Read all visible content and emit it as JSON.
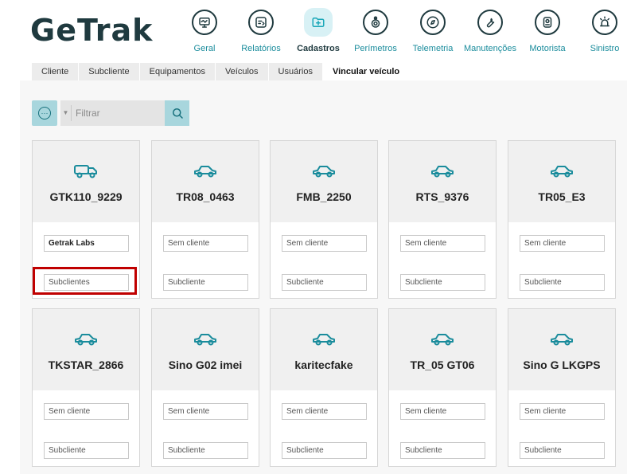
{
  "brand": {
    "logo_text": "GeTrak"
  },
  "nav": [
    {
      "label": "Geral",
      "icon": "monitor-icon",
      "active": false
    },
    {
      "label": "Relatórios",
      "icon": "report-icon",
      "active": false
    },
    {
      "label": "Cadastros",
      "icon": "folder-plus-icon",
      "active": true
    },
    {
      "label": "Perímetros",
      "icon": "geofence-icon",
      "active": false
    },
    {
      "label": "Telemetria",
      "icon": "compass-icon",
      "active": false
    },
    {
      "label": "Manutenções",
      "icon": "wrench-icon",
      "active": false
    },
    {
      "label": "Motorista",
      "icon": "driver-icon",
      "active": false
    },
    {
      "label": "Sinistro",
      "icon": "alarm-icon",
      "active": false
    }
  ],
  "tabs": [
    {
      "label": "Cliente",
      "active": false
    },
    {
      "label": "Subcliente",
      "active": false
    },
    {
      "label": "Equipamentos",
      "active": false
    },
    {
      "label": "Veículos",
      "active": false
    },
    {
      "label": "Usuários",
      "active": false
    },
    {
      "label": "Vincular veículo",
      "active": true
    }
  ],
  "toolbar": {
    "options_icon": "more-options-icon",
    "filter_placeholder": "Filtrar",
    "search_icon": "search-icon"
  },
  "colors": {
    "accent": "#1a8c9c",
    "accent_light": "#a8d6dd",
    "dark": "#1f3a3f",
    "highlight": "#c00000"
  },
  "vehicles": [
    {
      "name": "GTK110_9229",
      "icon": "truck-icon",
      "client_value": "Getrak Labs",
      "client_placeholder": "Sem cliente",
      "subclient_placeholder": "Subclientes"
    },
    {
      "name": "TR08_0463",
      "icon": "car-icon",
      "client_value": "",
      "client_placeholder": "Sem cliente",
      "subclient_placeholder": "Subcliente"
    },
    {
      "name": "FMB_2250",
      "icon": "car-icon",
      "client_value": "",
      "client_placeholder": "Sem cliente",
      "subclient_placeholder": "Subcliente"
    },
    {
      "name": "RTS_9376",
      "icon": "car-icon",
      "client_value": "",
      "client_placeholder": "Sem cliente",
      "subclient_placeholder": "Subcliente"
    },
    {
      "name": "TR05_E3",
      "icon": "car-icon",
      "client_value": "",
      "client_placeholder": "Sem cliente",
      "subclient_placeholder": "Subcliente"
    },
    {
      "name": "TKSTAR_2866",
      "icon": "car-icon",
      "client_value": "",
      "client_placeholder": "Sem cliente",
      "subclient_placeholder": "Subcliente"
    },
    {
      "name": "Sino G02 imei",
      "icon": "car-icon",
      "client_value": "",
      "client_placeholder": "Sem cliente",
      "subclient_placeholder": "Subcliente"
    },
    {
      "name": "karitecfake",
      "icon": "car-icon",
      "client_value": "",
      "client_placeholder": "Sem cliente",
      "subclient_placeholder": "Subcliente"
    },
    {
      "name": "TR_05 GT06",
      "icon": "car-icon",
      "client_value": "",
      "client_placeholder": "Sem cliente",
      "subclient_placeholder": "Subcliente"
    },
    {
      "name": "Sino G LKGPS",
      "icon": "car-icon",
      "client_value": "",
      "client_placeholder": "Sem cliente",
      "subclient_placeholder": "Subcliente"
    }
  ]
}
